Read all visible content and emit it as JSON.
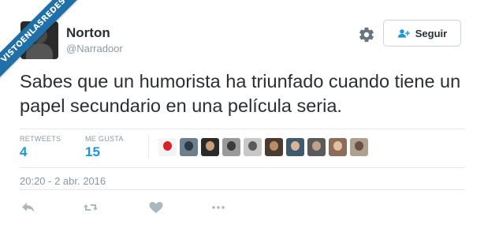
{
  "watermark": {
    "text": "VISTOENLASREDES"
  },
  "tweet": {
    "author": {
      "name": "Norton",
      "handle": "@Narradoor"
    },
    "follow_label": "Seguir",
    "text": "Sabes que un humorista ha triunfado cuando tiene un papel secundario en una película seria.",
    "stats": {
      "retweets_label": "RETWEETS",
      "retweets_value": "4",
      "likes_label": "ME GUSTA",
      "likes_value": "15"
    },
    "liker_count_shown": 10,
    "timestamp": "20:20 - 2 abr. 2016"
  },
  "colors": {
    "accent": "#1b95e0",
    "muted": "#8899a6",
    "watermark": "#1f6fa8"
  },
  "icons": [
    "gear-icon",
    "follow-user-icon",
    "reply-icon",
    "retweet-icon",
    "like-icon",
    "more-icon"
  ]
}
